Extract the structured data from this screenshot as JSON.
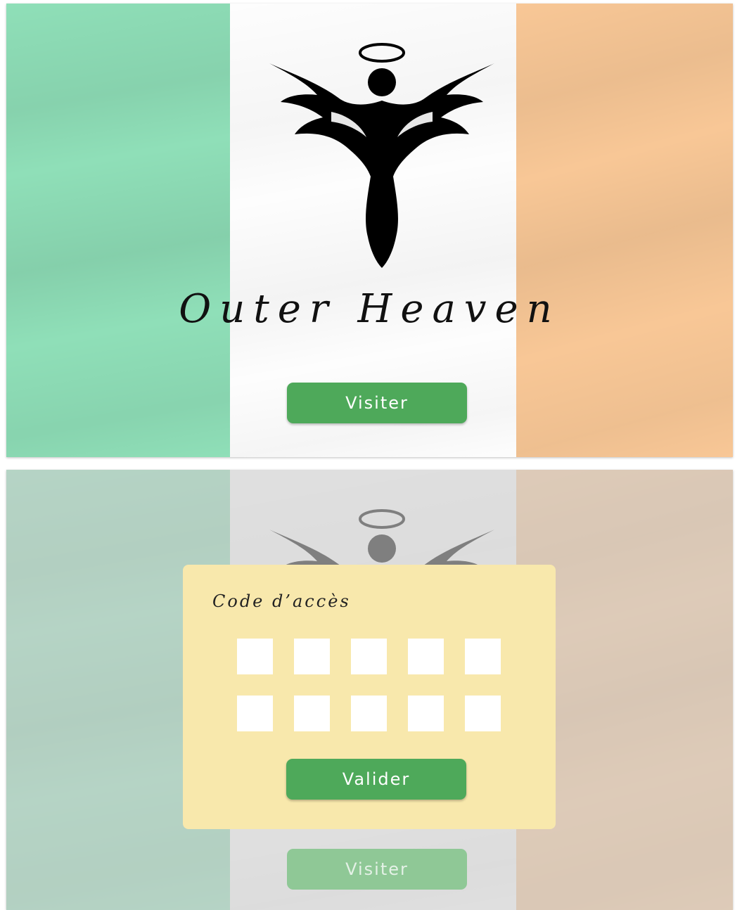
{
  "top_screen": {
    "title": "Outer Heaven",
    "visit_button": "Visiter"
  },
  "bottom_screen": {
    "visit_button": "Visiter",
    "modal": {
      "title": "Code d’accès",
      "code_boxes": [
        "",
        "",
        "",
        "",
        "",
        "",
        "",
        "",
        "",
        ""
      ],
      "validate_button": "Valider"
    }
  },
  "colors": {
    "flag_green": "#8fdfb8",
    "flag_white": "#fdfdfd",
    "flag_orange": "#f8c796",
    "button_green": "#4ea95a",
    "modal_background": "#f8e8ac"
  },
  "icons": {
    "logo": "angel-logo-icon"
  }
}
